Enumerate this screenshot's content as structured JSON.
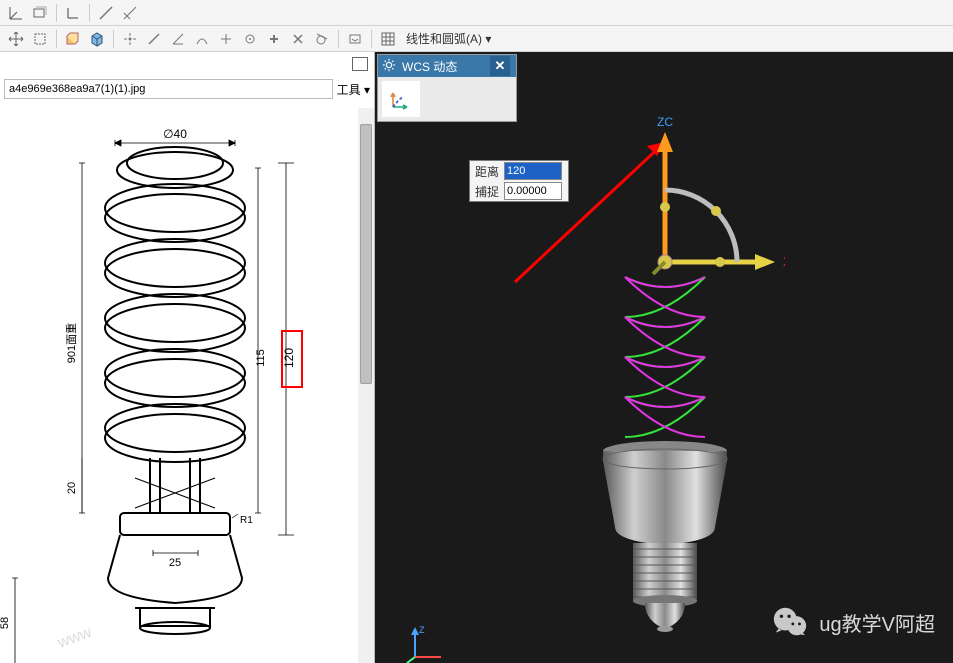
{
  "toolbar": {
    "menu_lines_arcs": "线性和圆弧(A)"
  },
  "left": {
    "path_value": "a4e969e368ea9a7(1)(1).jpg",
    "tools_label": "工具",
    "dims": {
      "d40": "∅40",
      "h_main": "901面重",
      "h115": "115",
      "h120": "120",
      "h20": "20",
      "w25": "25",
      "r_fillet": "R1",
      "h58": "58"
    }
  },
  "wcs": {
    "title": "WCS 动态",
    "dist_label": "距离",
    "dist_value": "120",
    "snap_label": "捕捉",
    "snap_value": "0.00000"
  },
  "axes": {
    "z": "ZC",
    "x": "XC",
    "y": "Z"
  },
  "watermark": "ug教学V阿超"
}
